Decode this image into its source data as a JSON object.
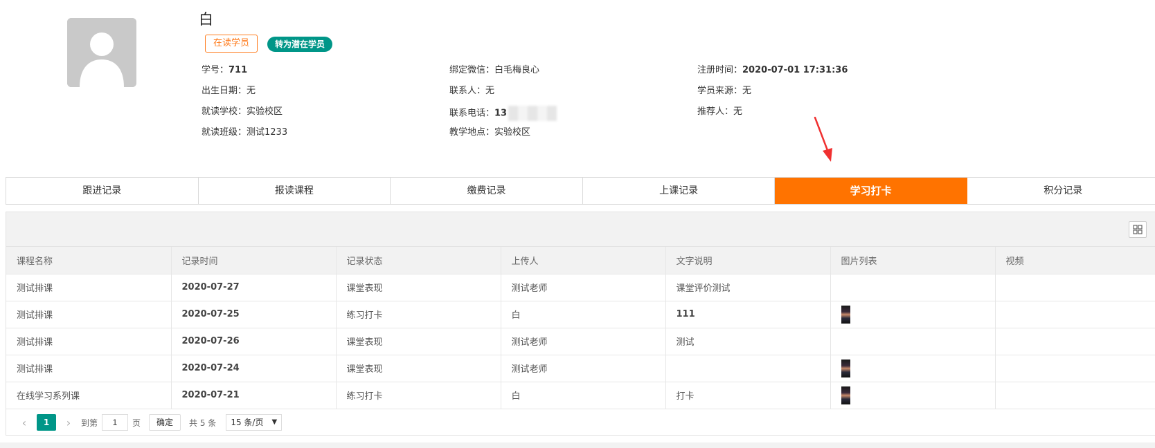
{
  "student": {
    "name": "白",
    "status_tag": "在读学员",
    "convert_button": "转为潜在学员"
  },
  "info": {
    "student_no_label": "学号：",
    "student_no": "711",
    "birthday_label": "出生日期：",
    "birthday": "无",
    "school_label": "就读学校：",
    "school": "实验校区",
    "class_label": "就读班级：",
    "class": "测试1233",
    "wechat_label": "绑定微信：",
    "wechat": "白毛梅良心",
    "contact_label": "联系人：",
    "contact": "无",
    "phone_label": "联系电话：",
    "phone_prefix": "13",
    "location_label": "教学地点：",
    "location": "实验校区",
    "register_label": "注册时间：",
    "register_time": "2020-07-01 17:31:36",
    "source_label": "学员来源：",
    "source": "无",
    "referrer_label": "推荐人：",
    "referrer": "无"
  },
  "tabs": [
    {
      "label": "跟进记录"
    },
    {
      "label": "报读课程"
    },
    {
      "label": "缴费记录"
    },
    {
      "label": "上课记录"
    },
    {
      "label": "学习打卡"
    },
    {
      "label": "积分记录"
    }
  ],
  "active_tab": "学习打卡",
  "table": {
    "headers": [
      "课程名称",
      "记录时间",
      "记录状态",
      "上传人",
      "文字说明",
      "图片列表",
      "视频"
    ],
    "rows": [
      {
        "course": "测试排课",
        "time": "2020-07-27",
        "status": "课堂表现",
        "uploader": "测试老师",
        "text": "课堂评价测试",
        "has_image": false
      },
      {
        "course": "测试排课",
        "time": "2020-07-25",
        "status": "练习打卡",
        "uploader": "白",
        "text": "111",
        "has_image": true
      },
      {
        "course": "测试排课",
        "time": "2020-07-26",
        "status": "课堂表现",
        "uploader": "测试老师",
        "text": "测试",
        "has_image": false
      },
      {
        "course": "测试排课",
        "time": "2020-07-24",
        "status": "课堂表现",
        "uploader": "测试老师",
        "text": "",
        "has_image": true
      },
      {
        "course": "在线学习系列课",
        "time": "2020-07-21",
        "status": "练习打卡",
        "uploader": "白",
        "text": "打卡",
        "has_image": true
      }
    ]
  },
  "pager": {
    "current_page": "1",
    "goto_label": "到第",
    "goto_value": "1",
    "page_label": "页",
    "confirm": "确定",
    "total": "共 5 条",
    "page_size": "15 条/页"
  },
  "colors": {
    "accent_orange": "#ff7300",
    "teal": "#009688"
  }
}
